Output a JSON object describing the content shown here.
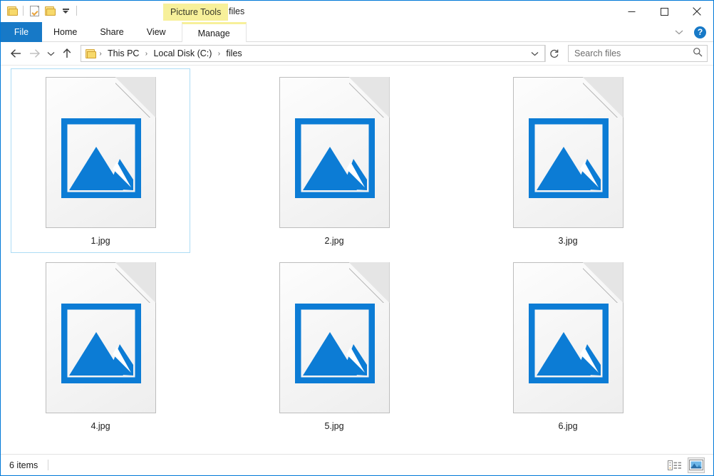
{
  "window": {
    "title": "files",
    "contextual_tools_label": "Picture Tools",
    "accent_color": "#1779c7",
    "contextual_color": "#f7f09a",
    "icon_blue": "#0c7cd5"
  },
  "quick_access": {
    "items": [
      {
        "name": "folder-icon",
        "tooltip": "files"
      },
      {
        "name": "properties-icon",
        "tooltip": "Properties"
      },
      {
        "name": "new-folder-icon",
        "tooltip": "New folder"
      },
      {
        "name": "customize-dropdown-icon",
        "tooltip": "Customize Quick Access Toolbar"
      }
    ]
  },
  "window_controls": {
    "minimize": "Minimize",
    "maximize": "Maximize",
    "close": "Close",
    "collapse_ribbon": "Minimize the Ribbon",
    "help": "?"
  },
  "ribbon": {
    "tabs": [
      {
        "label": "File",
        "type": "file",
        "selected": false
      },
      {
        "label": "Home",
        "type": "normal",
        "selected": false
      },
      {
        "label": "Share",
        "type": "normal",
        "selected": false
      },
      {
        "label": "View",
        "type": "normal",
        "selected": false
      },
      {
        "label": "Manage",
        "type": "contextual",
        "selected": true
      }
    ]
  },
  "navigation": {
    "back": "Back",
    "forward": "Forward",
    "recent": "Recent locations",
    "up": "Up one level",
    "breadcrumb": [
      {
        "label": "This PC"
      },
      {
        "label": "Local Disk (C:)"
      },
      {
        "label": "files"
      }
    ],
    "breadcrumb_separator": "›",
    "address_dropdown": "Previous Locations",
    "refresh": "Refresh"
  },
  "search": {
    "placeholder": "Search files",
    "value": ""
  },
  "files": [
    {
      "name": "1.jpg",
      "type": "image",
      "selected": true
    },
    {
      "name": "2.jpg",
      "type": "image",
      "selected": false
    },
    {
      "name": "3.jpg",
      "type": "image",
      "selected": false
    },
    {
      "name": "4.jpg",
      "type": "image",
      "selected": false
    },
    {
      "name": "5.jpg",
      "type": "image",
      "selected": false
    },
    {
      "name": "6.jpg",
      "type": "image",
      "selected": false
    }
  ],
  "status": {
    "item_count": "6 items",
    "view_details": "Details view",
    "view_large_icons": "Large icons view"
  }
}
